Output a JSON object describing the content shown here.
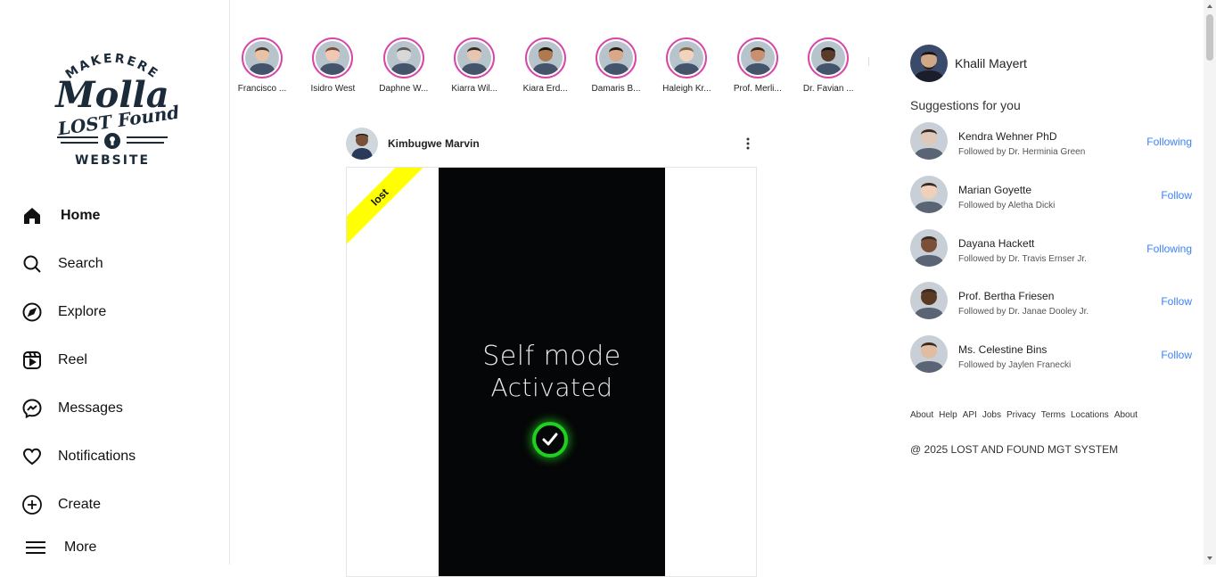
{
  "logo": {
    "line1": "MAKERERE",
    "line2": "Molla",
    "line3": "LOST Found",
    "line4": "WEBSITE"
  },
  "nav": [
    {
      "label": "Home",
      "icon": "home-icon",
      "active": true
    },
    {
      "label": "Search",
      "icon": "search-icon"
    },
    {
      "label": "Explore",
      "icon": "compass-icon"
    },
    {
      "label": "Reel",
      "icon": "reel-icon"
    },
    {
      "label": "Messages",
      "icon": "messenger-icon"
    },
    {
      "label": "Notifications",
      "icon": "heart-icon"
    },
    {
      "label": "Create",
      "icon": "plus-square-icon"
    },
    {
      "label": "More",
      "icon": "menu-icon"
    }
  ],
  "stories": [
    {
      "name": "Francisco ...",
      "skin": "#e8c2a4",
      "hair": "#4a3628"
    },
    {
      "name": "Isidro West",
      "skin": "#f0c8b4",
      "hair": "#7a4a32"
    },
    {
      "name": "Daphne W...",
      "skin": "#d8d8d8",
      "hair": "#5a5a5a"
    },
    {
      "name": "Kiarra Wil...",
      "skin": "#e6c6b0",
      "hair": "#3a2a20"
    },
    {
      "name": "Kiara Erd...",
      "skin": "#b07a50",
      "hair": "#1e1410"
    },
    {
      "name": "Damaris B...",
      "skin": "#d8a888",
      "hair": "#2a1a14"
    },
    {
      "name": "Haleigh Kr...",
      "skin": "#f0d4c0",
      "hair": "#8a6442"
    },
    {
      "name": "Prof. Merli...",
      "skin": "#c89070",
      "hair": "#3a2418"
    },
    {
      "name": "Dr. Favian ...",
      "skin": "#5a3a28",
      "hair": "#141010"
    }
  ],
  "post": {
    "username": "Kimbugwe Marvin",
    "tag": "lost",
    "text_line1": "Self mode",
    "text_line2": "Activated"
  },
  "profile": {
    "name": "Khalil Mayert"
  },
  "suggestions_title": "Suggestions for you",
  "suggestions": [
    {
      "name": "Kendra Wehner PhD",
      "followed_by": "Followed by Dr. Herminia Green",
      "action": "Following",
      "skin": "#e0c8b8"
    },
    {
      "name": "Marian Goyette",
      "followed_by": "Followed by Aletha Dicki",
      "action": "Follow",
      "skin": "#f0d0b8"
    },
    {
      "name": "Dayana Hackett",
      "followed_by": "Followed by Dr. Travis Ernser Jr.",
      "action": "Following",
      "skin": "#7a5038"
    },
    {
      "name": "Prof. Bertha Friesen",
      "followed_by": "Followed by Dr. Janae Dooley Jr.",
      "action": "Follow",
      "skin": "#5a3a24"
    },
    {
      "name": "Ms. Celestine Bins",
      "followed_by": "Followed by Jaylen Franecki",
      "action": "Follow",
      "skin": "#e0bca0"
    }
  ],
  "footer_links": [
    "About",
    "Help",
    "API",
    "Jobs",
    "Privacy",
    "Terms",
    "Locations",
    "About"
  ],
  "copyright": "@ 2025 LOST AND FOUND MGT SYSTEM",
  "colors": {
    "accent": "#3b82f6",
    "story_ring": "#d946a8",
    "tag": "#ffff00"
  }
}
